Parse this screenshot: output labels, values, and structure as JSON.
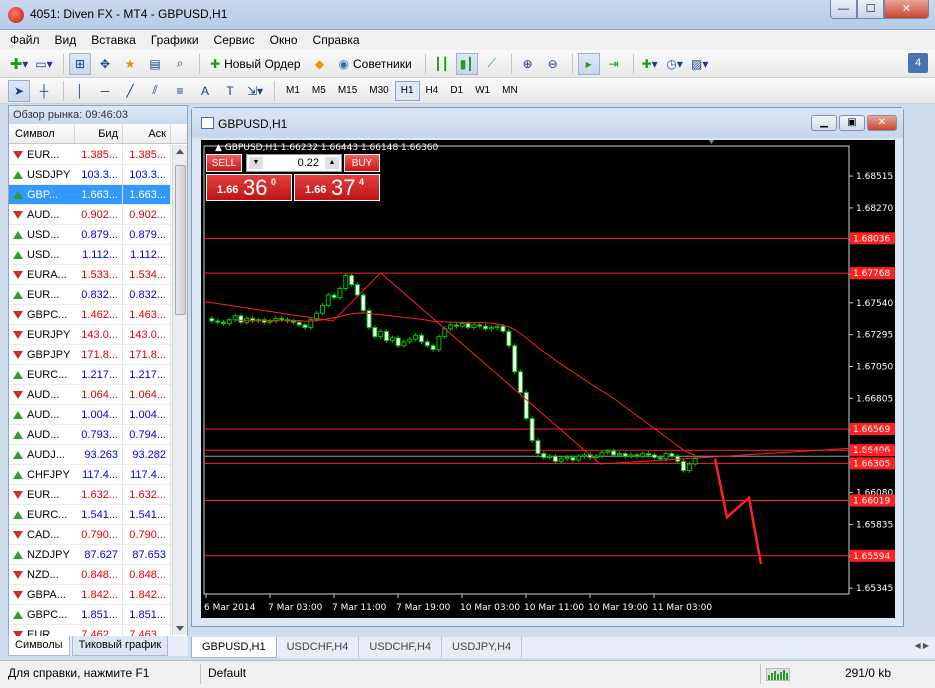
{
  "window": {
    "title": "4051: Diven FX - MT4 - GBPUSD,H1",
    "min": "—",
    "max": "☐",
    "close": "✕"
  },
  "menu": [
    "Файл",
    "Вид",
    "Вставка",
    "Графики",
    "Сервис",
    "Окно",
    "Справка"
  ],
  "toolbar": {
    "new_order": "Новый Ордер",
    "advisors": "Советники",
    "notifications_count": "4"
  },
  "timeframes": [
    "M1",
    "M5",
    "M15",
    "M30",
    "H1",
    "H4",
    "D1",
    "W1",
    "MN"
  ],
  "active_timeframe": "H1",
  "market_watch": {
    "header": "Обзор рынка: 09:46:03",
    "col_symbol": "Символ",
    "col_bid": "Бид",
    "col_ask": "Аск",
    "rows": [
      {
        "symbol": "EUR...",
        "bid": "1.385...",
        "ask": "1.385...",
        "dir": "down",
        "color": "red"
      },
      {
        "symbol": "USDJPY",
        "bid": "103.3...",
        "ask": "103.3...",
        "dir": "up",
        "color": "blue"
      },
      {
        "symbol": "GBP...",
        "bid": "1.663...",
        "ask": "1.663...",
        "dir": "up",
        "color": "blue",
        "selected": true
      },
      {
        "symbol": "AUD...",
        "bid": "0.902...",
        "ask": "0.902...",
        "dir": "down",
        "color": "red"
      },
      {
        "symbol": "USD...",
        "bid": "0.879...",
        "ask": "0.879...",
        "dir": "up",
        "color": "blue"
      },
      {
        "symbol": "USD...",
        "bid": "1.112...",
        "ask": "1.112...",
        "dir": "up",
        "color": "blue"
      },
      {
        "symbol": "EURA...",
        "bid": "1.533...",
        "ask": "1.534...",
        "dir": "down",
        "color": "red"
      },
      {
        "symbol": "EUR...",
        "bid": "0.832...",
        "ask": "0.832...",
        "dir": "up",
        "color": "blue"
      },
      {
        "symbol": "GBPC...",
        "bid": "1.462...",
        "ask": "1.463...",
        "dir": "down",
        "color": "red"
      },
      {
        "symbol": "EURJPY",
        "bid": "143.0...",
        "ask": "143.0...",
        "dir": "down",
        "color": "red"
      },
      {
        "symbol": "GBPJPY",
        "bid": "171.8...",
        "ask": "171.8...",
        "dir": "down",
        "color": "red"
      },
      {
        "symbol": "EURC...",
        "bid": "1.217...",
        "ask": "1.217...",
        "dir": "up",
        "color": "blue"
      },
      {
        "symbol": "AUD...",
        "bid": "1.064...",
        "ask": "1.064...",
        "dir": "down",
        "color": "red"
      },
      {
        "symbol": "AUD...",
        "bid": "1.004...",
        "ask": "1.004...",
        "dir": "up",
        "color": "blue"
      },
      {
        "symbol": "AUD...",
        "bid": "0.793...",
        "ask": "0.794...",
        "dir": "up",
        "color": "blue"
      },
      {
        "symbol": "AUDJ...",
        "bid": "93.263",
        "ask": "93.282",
        "dir": "up",
        "color": "blue"
      },
      {
        "symbol": "CHFJPY",
        "bid": "117.4...",
        "ask": "117.4...",
        "dir": "up",
        "color": "blue"
      },
      {
        "symbol": "EUR...",
        "bid": "1.632...",
        "ask": "1.632...",
        "dir": "down",
        "color": "red"
      },
      {
        "symbol": "EURC...",
        "bid": "1.541...",
        "ask": "1.541...",
        "dir": "up",
        "color": "blue"
      },
      {
        "symbol": "CAD...",
        "bid": "0.790...",
        "ask": "0.790...",
        "dir": "down",
        "color": "red"
      },
      {
        "symbol": "NZDJPY",
        "bid": "87.627",
        "ask": "87.653",
        "dir": "up",
        "color": "blue"
      },
      {
        "symbol": "NZD...",
        "bid": "0.848...",
        "ask": "0.848...",
        "dir": "down",
        "color": "red"
      },
      {
        "symbol": "GBPA...",
        "bid": "1.842...",
        "ask": "1.842...",
        "dir": "down",
        "color": "red"
      },
      {
        "symbol": "GBPC...",
        "bid": "1.851...",
        "ask": "1.851...",
        "dir": "up",
        "color": "blue"
      },
      {
        "symbol": "EUR...",
        "bid": "7.462...",
        "ask": "7.463...",
        "dir": "down",
        "color": "red"
      }
    ],
    "tabs": [
      "Символы",
      "Тиковый график"
    ]
  },
  "chart_window": {
    "title": "GBPUSD,H1",
    "info_line": "GBPUSD,H1  1.66232 1.66443 1.66148 1.66360",
    "trade": {
      "sell_label": "SELL",
      "buy_label": "BUY",
      "lot": "0.22",
      "sell_prefix": "1.66",
      "sell_big": "36",
      "sell_sup": "0",
      "buy_prefix": "1.66",
      "buy_big": "37",
      "buy_sup": "4"
    }
  },
  "chart_data": {
    "type": "candlestick",
    "y_axis_ticks": [
      "1.68515",
      "1.68270",
      "1.68025",
      "1.67760",
      "1.67540",
      "1.67295",
      "1.67050",
      "1.66805",
      "1.66560",
      "1.66315",
      "1.66080",
      "1.65835",
      "1.65590",
      "1.65345"
    ],
    "x_axis_ticks": [
      "6 Mar 2014",
      "7 Mar 03:00",
      "7 Mar 11:00",
      "7 Mar 19:00",
      "10 Mar 03:00",
      "10 Mar 11:00",
      "10 Mar 19:00",
      "11 Mar 03:00"
    ],
    "level_labels": [
      {
        "price": 1.68036,
        "label": "1.68036"
      },
      {
        "price": 1.67768,
        "label": "1.67768"
      },
      {
        "price": 1.66569,
        "label": "1.66569"
      },
      {
        "price": 1.66406,
        "label": "1.66406"
      },
      {
        "price": 1.66305,
        "label": "1.66305"
      },
      {
        "price": 1.66019,
        "label": "1.66019"
      },
      {
        "price": 1.65594,
        "label": "1.65594"
      }
    ],
    "current_price": 1.6636,
    "ylim": [
      1.653,
      1.687
    ]
  },
  "chart_tabs": [
    "GBPUSD,H1",
    "USDCHF,H4",
    "USDCHF,H4",
    "USDJPY,H4"
  ],
  "status": {
    "help": "Для справки, нажмите F1",
    "profile": "Default",
    "traffic": "291/0 kb"
  },
  "colors": {
    "bull": "#00c000",
    "bear": "#ffffff",
    "level": "#ff2020",
    "grid": "#555555"
  }
}
